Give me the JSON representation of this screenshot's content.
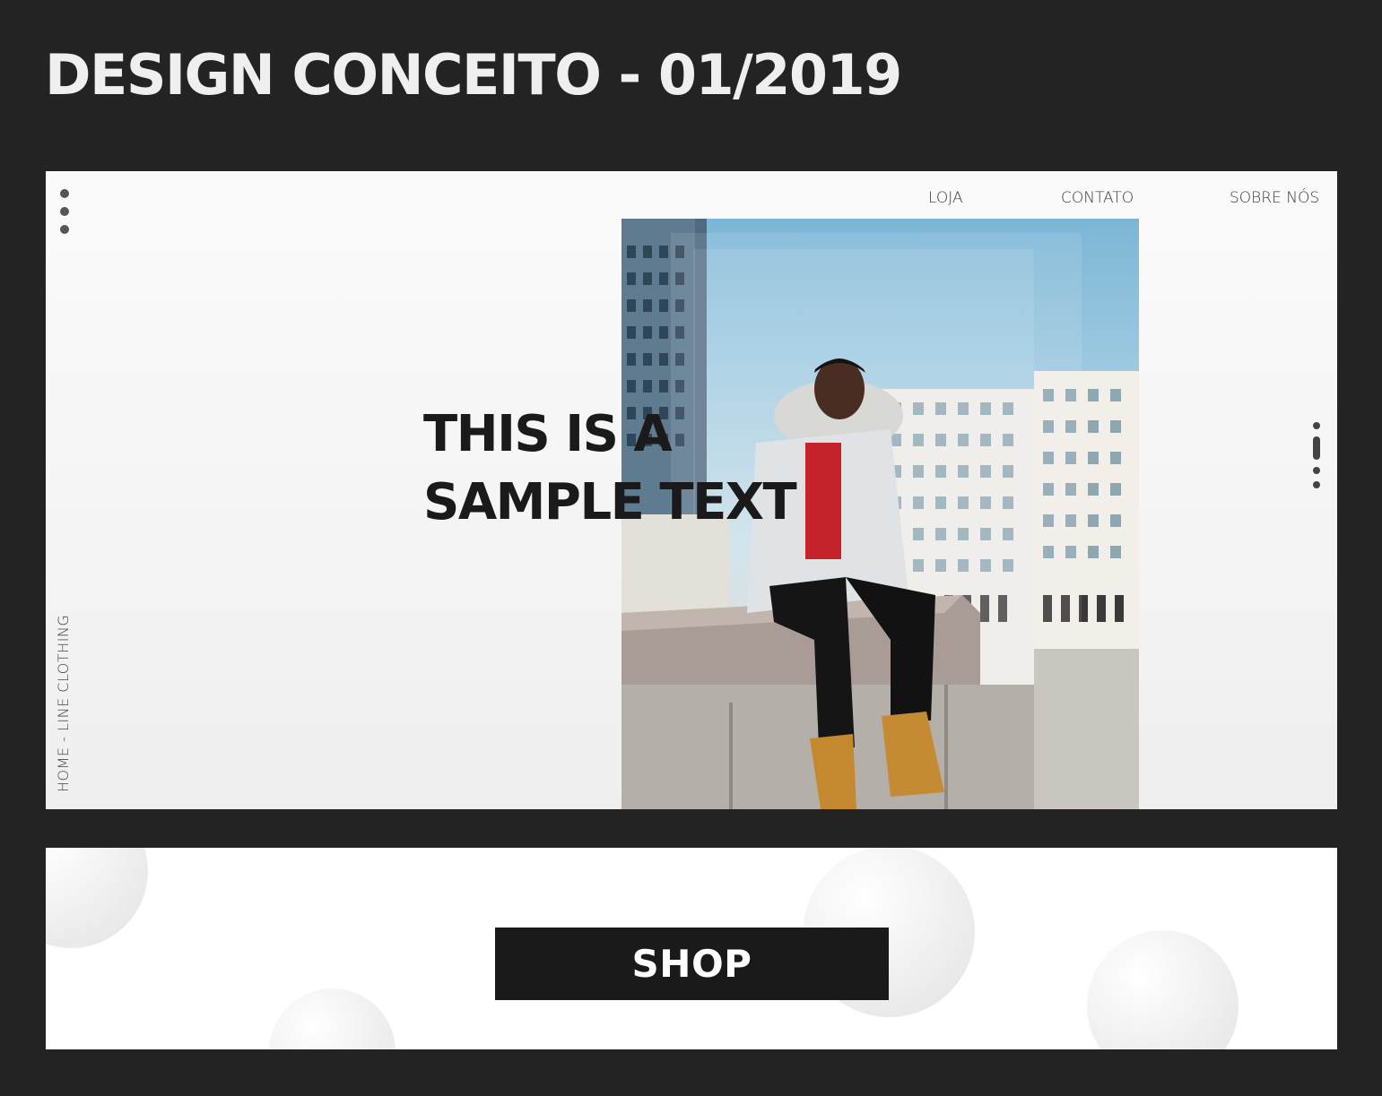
{
  "page": {
    "heading": "DESIGN CONCEITO - 01/2019"
  },
  "hero": {
    "nav": {
      "loja": "LOJA",
      "contato": "CONTATO",
      "sobre": "SOBRE NÓS"
    },
    "headline_line1": "THIS IS A",
    "headline_line2": "SAMPLE TEXT",
    "breadcrumb": "HOME - LINE  CLOTHING",
    "menu_icon": "vertical-dots-icon",
    "scroll_icon": "scroll-indicator-icon",
    "photo_description_icon": "model-photo"
  },
  "shop": {
    "button_label": "SHOP"
  },
  "colors": {
    "background": "#232323",
    "panel": "#fbfbfb",
    "text_dark": "#1a1a1a",
    "button": "#1a1a1a",
    "sky": "#7cb6d6"
  }
}
